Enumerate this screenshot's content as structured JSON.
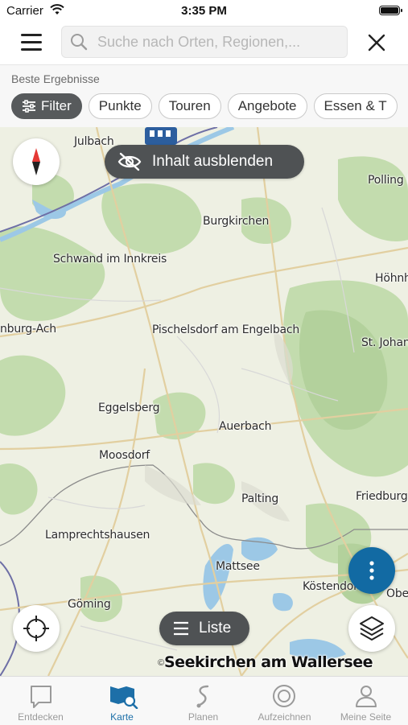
{
  "status_bar": {
    "carrier": "Carrier",
    "time": "3:35 PM"
  },
  "search": {
    "placeholder": "Suche nach Orten, Regionen,..."
  },
  "filters": {
    "caption": "Beste Ergebnisse",
    "chips": [
      "Filter",
      "Punkte",
      "Touren",
      "Angebote",
      "Essen & T"
    ]
  },
  "map": {
    "hide_content_label": "Inhalt ausblenden",
    "list_label": "Liste",
    "copyright": "©",
    "places": {
      "julbach": "Julbach",
      "burgkirchen": "Burgkirchen",
      "polling": "Polling in",
      "schwand": "Schwand im Innkreis",
      "hoehnh": "Höhnh",
      "burg_ach": "nburg-Ach",
      "pischelsdorf": "Pischelsdorf am Engelbach",
      "st_johann": "St. Johann",
      "eggelsberg": "Eggelsberg",
      "auerbach": "Auerbach",
      "moosdorf": "Moosdorf",
      "palting": "Palting",
      "friedburg": "Friedburg",
      "lamprechtshausen": "Lamprechtshausen",
      "mattsee": "Mattsee",
      "koestendorf": "Köstendorf",
      "ober": "Ober",
      "goeming": "Göming",
      "seekirchen": "Seekirchen am Wallersee"
    }
  },
  "tabs": [
    {
      "label": "Entdecken",
      "active": false
    },
    {
      "label": "Karte",
      "active": true
    },
    {
      "label": "Planen",
      "active": false
    },
    {
      "label": "Aufzeichnen",
      "active": false
    },
    {
      "label": "Meine Seite",
      "active": false
    }
  ],
  "colors": {
    "accent": "#1d6fa8",
    "action_blue": "#126aa3",
    "dark_pill": "#4f5254"
  }
}
